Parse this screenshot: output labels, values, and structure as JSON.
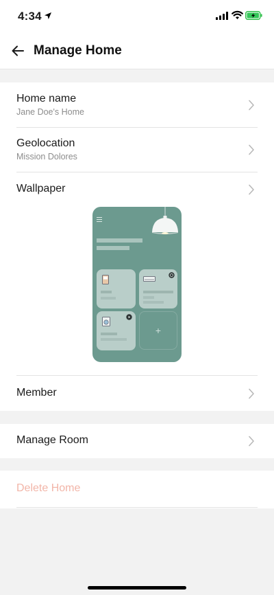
{
  "status_bar": {
    "time": "4:34"
  },
  "header": {
    "title": "Manage Home"
  },
  "rows": {
    "home_name": {
      "label": "Home name",
      "value": "Jane Doe's Home"
    },
    "geolocation": {
      "label": "Geolocation",
      "value": "Mission Dolores"
    },
    "wallpaper": {
      "label": "Wallpaper"
    },
    "member": {
      "label": "Member"
    },
    "manage_room": {
      "label": "Manage Room"
    },
    "delete_home": {
      "label": "Delete Home"
    }
  },
  "wallpaper_preview": {
    "background_color": "#6c9a8f",
    "add_symbol": "+"
  },
  "colors": {
    "delete_text": "#f2b5a8",
    "page_background": "#f2f2f2"
  }
}
